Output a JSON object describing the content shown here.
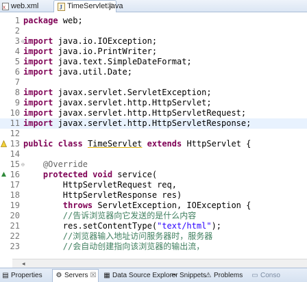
{
  "tabs": [
    {
      "label": "web.xml",
      "icon": "xml-file-icon"
    },
    {
      "label": "TimeServlet.java",
      "icon": "java-file-icon",
      "active": true,
      "close": "☒"
    }
  ],
  "lines": [
    {
      "n": "1",
      "tokens": [
        [
          "kw",
          "package"
        ],
        [
          "t",
          " web;"
        ]
      ]
    },
    {
      "n": "2",
      "tokens": []
    },
    {
      "n": "3",
      "fold": "⊖",
      "tokens": [
        [
          "kw",
          "import"
        ],
        [
          "t",
          " java.io.IOException;"
        ]
      ]
    },
    {
      "n": "4",
      "tokens": [
        [
          "kw",
          "import"
        ],
        [
          "t",
          " java.io.PrintWriter;"
        ]
      ]
    },
    {
      "n": "5",
      "tokens": [
        [
          "kw",
          "import"
        ],
        [
          "t",
          " java.text.SimpleDateFormat;"
        ]
      ]
    },
    {
      "n": "6",
      "tokens": [
        [
          "kw",
          "import"
        ],
        [
          "t",
          " java.util.Date;"
        ]
      ]
    },
    {
      "n": "7",
      "tokens": []
    },
    {
      "n": "8",
      "tokens": [
        [
          "kw",
          "import"
        ],
        [
          "t",
          " javax.servlet.ServletException;"
        ]
      ]
    },
    {
      "n": "9",
      "tokens": [
        [
          "kw",
          "import"
        ],
        [
          "t",
          " javax.servlet.http.HttpServlet;"
        ]
      ]
    },
    {
      "n": "10",
      "tokens": [
        [
          "kw",
          "import"
        ],
        [
          "t",
          " javax.servlet.http.HttpServletRequest;"
        ]
      ]
    },
    {
      "n": "11",
      "tokens": [
        [
          "kw",
          "import"
        ],
        [
          "t",
          " javax.servlet.http.HttpServletResponse;"
        ]
      ],
      "highlight": true
    },
    {
      "n": "12",
      "tokens": []
    },
    {
      "n": "13",
      "mark": "warning",
      "tokens": [
        [
          "kw",
          "public class"
        ],
        [
          "t",
          " "
        ],
        [
          "ul",
          "TimeServlet"
        ],
        [
          "t",
          " "
        ],
        [
          "kw",
          "extends"
        ],
        [
          "t",
          " HttpServlet {"
        ]
      ]
    },
    {
      "n": "14",
      "tokens": []
    },
    {
      "n": "15",
      "fold": "⊖",
      "tokens": [
        [
          "t",
          "    "
        ],
        [
          "an",
          "@Override"
        ]
      ]
    },
    {
      "n": "16",
      "mark": "override",
      "tokens": [
        [
          "t",
          "    "
        ],
        [
          "kw",
          "protected void"
        ],
        [
          "t",
          " service("
        ]
      ]
    },
    {
      "n": "17",
      "tokens": [
        [
          "t",
          "        HttpServletRequest req,"
        ]
      ]
    },
    {
      "n": "18",
      "tokens": [
        [
          "t",
          "        HttpServletResponse res)"
        ]
      ]
    },
    {
      "n": "19",
      "tokens": [
        [
          "t",
          "        "
        ],
        [
          "kw",
          "throws"
        ],
        [
          "t",
          " ServletException, IOException {"
        ]
      ]
    },
    {
      "n": "20",
      "tokens": [
        [
          "t",
          "        "
        ],
        [
          "cm",
          "//告诉浏览器向它发送的是什么内容"
        ]
      ]
    },
    {
      "n": "21",
      "tokens": [
        [
          "t",
          "        res.setContentType("
        ],
        [
          "str",
          "\"text/html\""
        ],
        [
          "t",
          ");"
        ]
      ]
    },
    {
      "n": "22",
      "tokens": [
        [
          "t",
          "        "
        ],
        [
          "cm",
          "//浏览器输入地址访问服务器时，服务器"
        ]
      ]
    },
    {
      "n": "23",
      "tokens": [
        [
          "t",
          "        "
        ],
        [
          "cm",
          "//会自动创建指向该浏览器的输出流，"
        ]
      ]
    }
  ],
  "scrollbar": {
    "left_arrow": "◂"
  },
  "views": [
    {
      "label": "Properties",
      "icon": "properties-icon",
      "glyph": "▤"
    },
    {
      "label": "Servers",
      "icon": "servers-icon",
      "glyph": "⚙",
      "active": true,
      "close": "☒"
    },
    {
      "label": "Data Source Explorer",
      "icon": "data-source-icon",
      "glyph": "▦"
    },
    {
      "label": "Snippets",
      "icon": "snippets-icon",
      "glyph": "✂"
    },
    {
      "label": "Problems",
      "icon": "problems-icon",
      "glyph": "⚠"
    },
    {
      "label": "Conso",
      "icon": "console-icon",
      "glyph": "▭"
    }
  ],
  "colors": {
    "keyword": "#7f0055",
    "string": "#2a00ff",
    "comment": "#3f7f5f",
    "annotation": "#646464",
    "line_highlight": "#e8f2fe"
  }
}
